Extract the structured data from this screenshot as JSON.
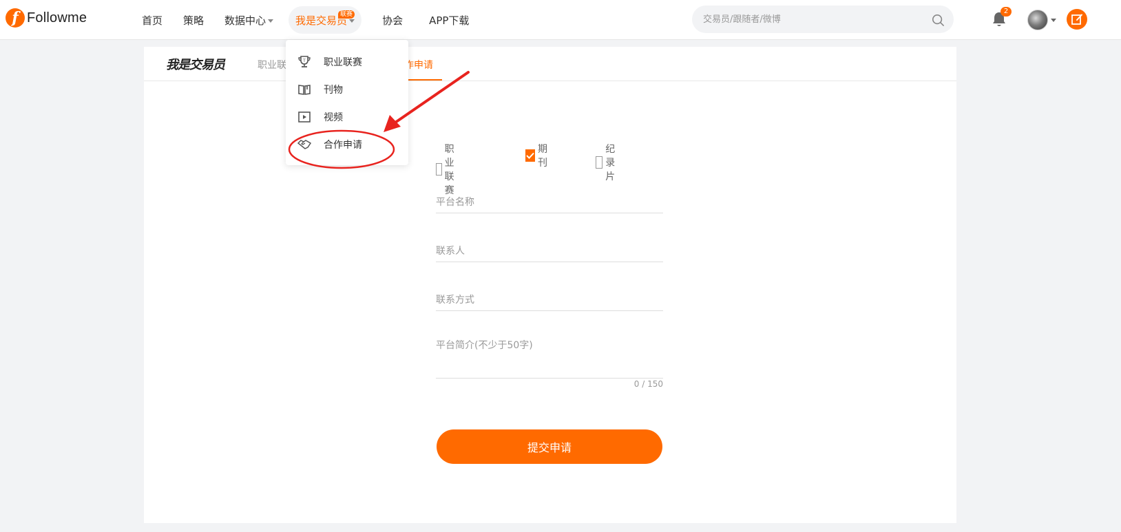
{
  "brand": {
    "logo_letter": "f",
    "logo_text": "Followme"
  },
  "nav": {
    "home": "首页",
    "strategy": "策略",
    "data_center": "数据中心",
    "trader": "我是交易员",
    "trader_badge": "联赛",
    "association": "协会",
    "app_download": "APP下载"
  },
  "search": {
    "placeholder": "交易员/跟随者/微博"
  },
  "notifications": {
    "count": "2"
  },
  "subnav": {
    "brand": "我是交易员",
    "tab_league": "职业联",
    "tab_apply": "作申请"
  },
  "dropdown": {
    "items": [
      {
        "label": "职业联赛",
        "icon": "trophy-icon"
      },
      {
        "label": "刊物",
        "icon": "book-icon"
      },
      {
        "label": "视频",
        "icon": "video-icon"
      },
      {
        "label": "合作申请",
        "icon": "handshake-icon"
      }
    ]
  },
  "form": {
    "options": [
      {
        "label": "职业联赛",
        "checked": false
      },
      {
        "label": "期刊",
        "checked": true
      },
      {
        "label": "纪录片",
        "checked": false
      }
    ],
    "platform_name_placeholder": "平台名称",
    "contact_person_placeholder": "联系人",
    "contact_method_placeholder": "联系方式",
    "intro_placeholder": "平台简介(不少于50字)",
    "counter": "0 / 150",
    "submit": "提交申请"
  },
  "colors": {
    "accent": "#ff6a00",
    "annotation": "#e8231e"
  }
}
